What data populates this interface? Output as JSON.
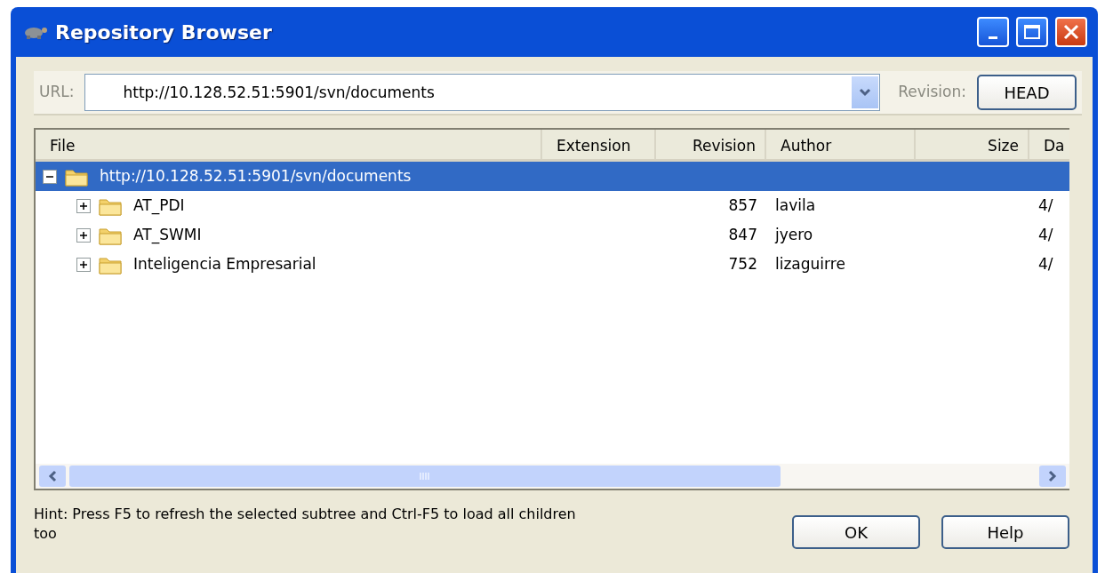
{
  "window": {
    "title": "Repository Browser"
  },
  "url_bar": {
    "label": "URL:",
    "value": "http://10.128.52.51:5901/svn/documents",
    "revision_label": "Revision:",
    "revision_button": "HEAD"
  },
  "columns": [
    "File",
    "Extension",
    "Revision",
    "Author",
    "Size",
    "Da"
  ],
  "tree": [
    {
      "label": "http://10.128.52.51:5901/svn/documents",
      "expanded": true,
      "selected": true,
      "children": [
        {
          "label": "AT_PDI",
          "expanded": false,
          "selected": false,
          "revision": "857",
          "author": "lavila",
          "date": "4/"
        },
        {
          "label": "AT_SWMI",
          "expanded": false,
          "selected": false,
          "revision": "847",
          "author": "jyero",
          "date": "4/"
        },
        {
          "label": "Inteligencia Empresarial",
          "expanded": false,
          "selected": false,
          "revision": "752",
          "author": "lizaguirre",
          "date": "4/"
        }
      ]
    }
  ],
  "hint": "Hint: Press F5 to refresh the selected subtree and Ctrl-F5 to load all children too",
  "buttons": [
    "OK",
    "Help"
  ]
}
